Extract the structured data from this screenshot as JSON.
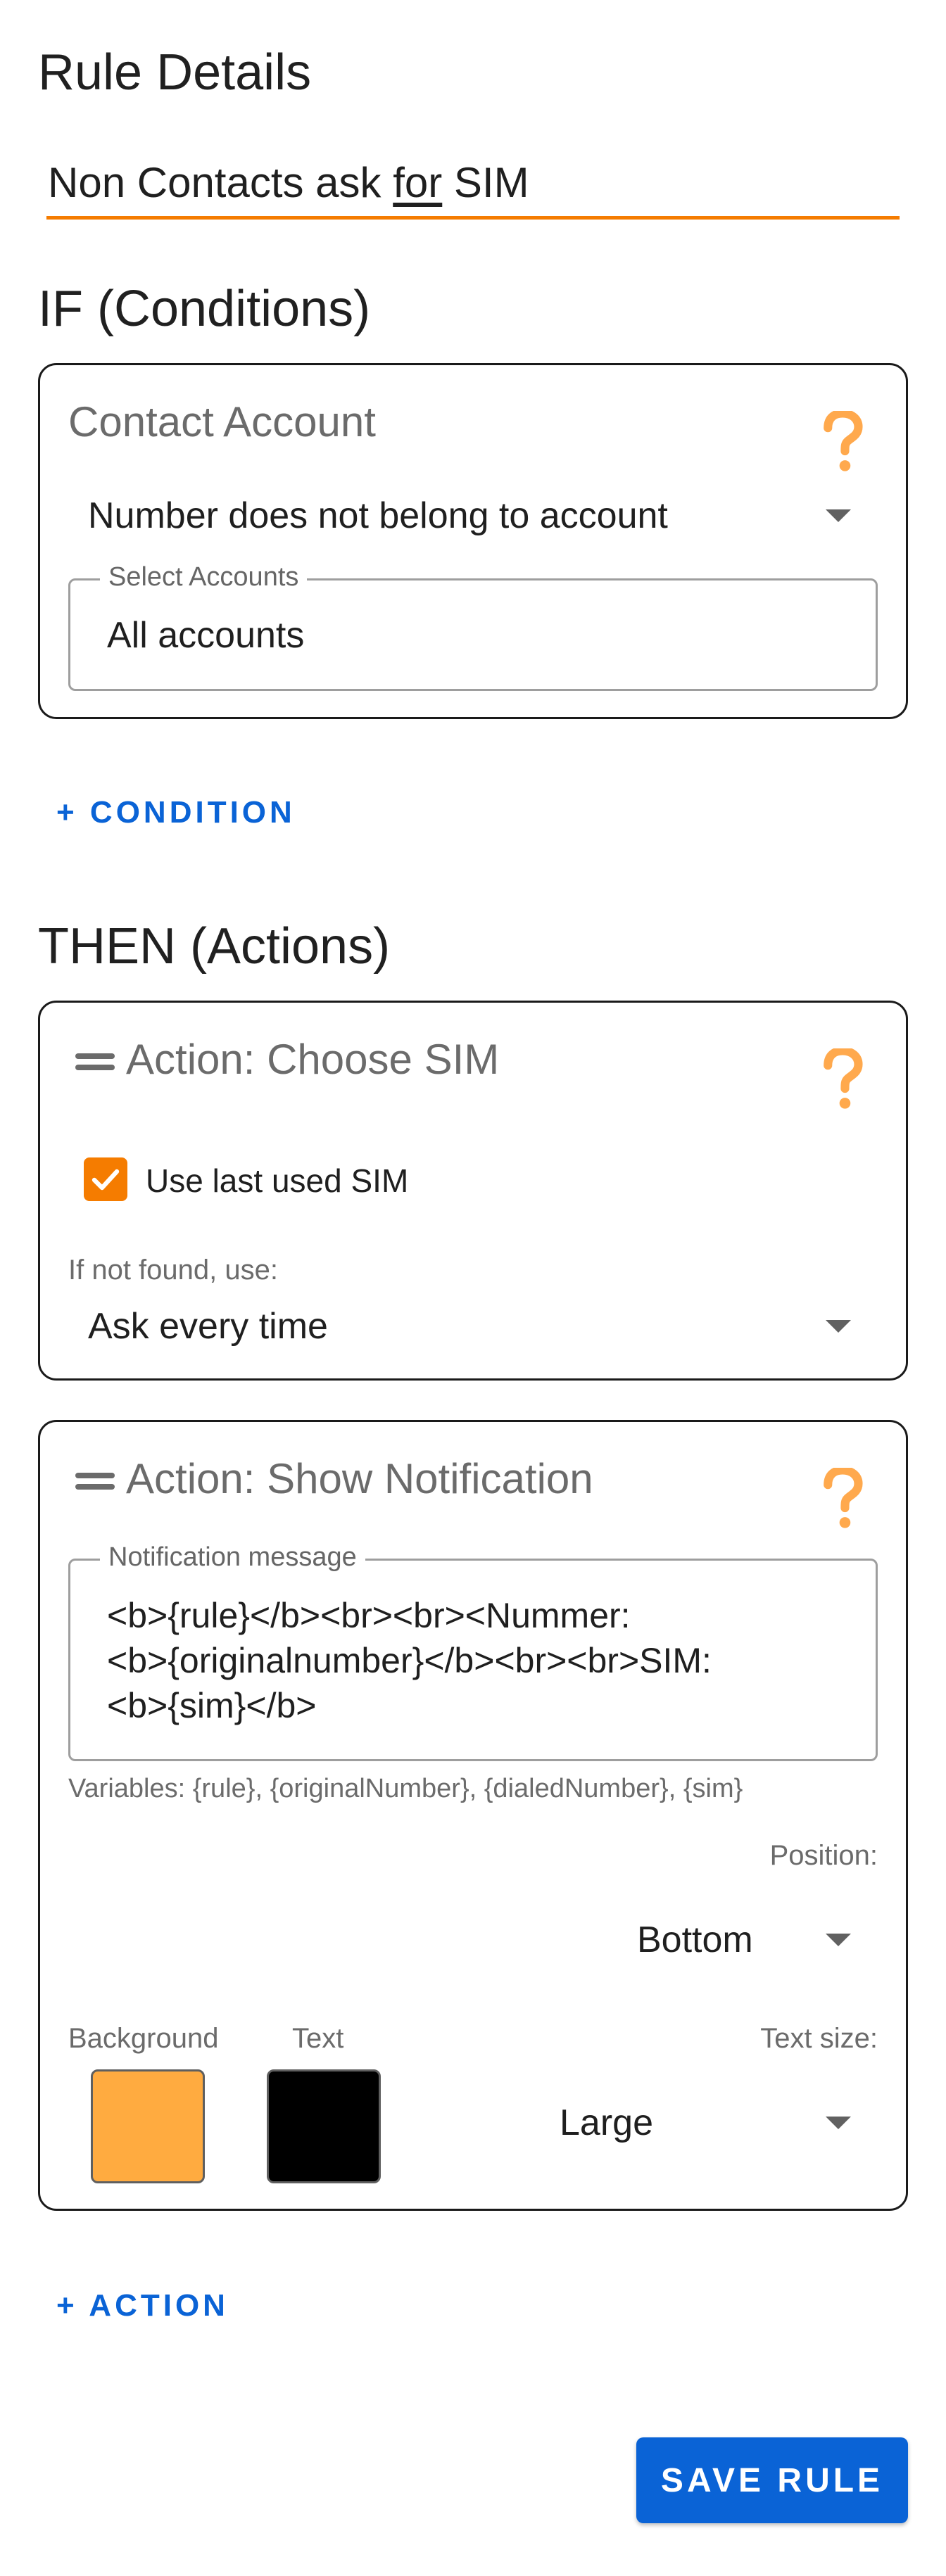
{
  "header": {
    "title": "Rule Details"
  },
  "rule_name": {
    "before": "Non Contacts ask ",
    "underlined": "for",
    "after": " SIM"
  },
  "conditions": {
    "heading": "IF (Conditions)",
    "card": {
      "title": "Contact Account",
      "selected": "Number does not belong to account",
      "accounts_label": "Select Accounts",
      "accounts_value": "All accounts"
    },
    "add_label": "+ CONDITION"
  },
  "actions": {
    "heading": "THEN (Actions)",
    "choose_sim": {
      "title": "Action: Choose SIM",
      "checkbox_label": "Use last used SIM",
      "checkbox_checked": true,
      "fallback_label": "If not found, use:",
      "fallback_value": "Ask every time"
    },
    "notification": {
      "title": "Action: Show Notification",
      "message_label": "Notification message",
      "message_value": "<b>{rule}</b><br><br><Nummer:\n<b>{originalnumber}</b><br><br>SIM:\n<b>{sim}</b>",
      "variables_hint": "Variables: {rule}, {originalNumber}, {dialedNumber}, {sim}",
      "position_label": "Position:",
      "position_value": "Bottom",
      "background_label": "Background",
      "background_color": "#FFAB40",
      "text_label": "Text",
      "text_color": "#000000",
      "text_size_label": "Text size:",
      "text_size_value": "Large"
    },
    "add_label": "+ ACTION"
  },
  "save_label": "SAVE RULE",
  "colors": {
    "accent": "#F57C00",
    "primary": "#0A63D6",
    "help_icon": "#FFA94D"
  },
  "icons": [
    "help-question-icon",
    "drag-handle-icon",
    "checkmark-icon",
    "dropdown-caret-icon"
  ]
}
